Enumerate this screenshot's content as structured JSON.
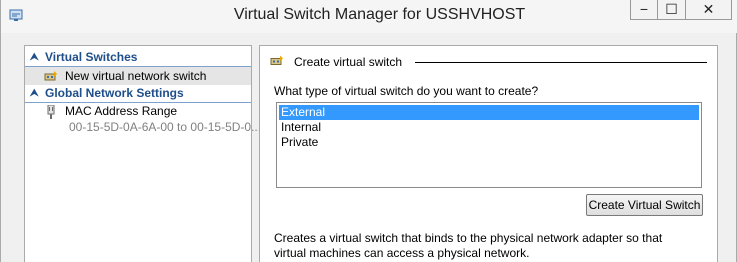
{
  "window": {
    "title": "Virtual Switch Manager for USSHVHOST",
    "minimize_glyph": "−",
    "maximize_glyph": "☐",
    "close_glyph": "✕"
  },
  "nav": {
    "virtual_switches_header": "Virtual Switches",
    "new_switch_item": "New virtual network switch",
    "global_settings_header": "Global Network Settings",
    "mac_range_label": "MAC Address Range",
    "mac_range_value": "00-15-5D-0A-6A-00 to 00-15-5D-0...",
    "collapse_glyph": "⮝"
  },
  "detail": {
    "header": "Create virtual switch",
    "question": "What type of virtual switch do you want to create?",
    "switch_types": [
      "External",
      "Internal",
      "Private"
    ],
    "selected_index": 0,
    "create_button": "Create Virtual Switch",
    "description": "Creates a virtual switch that binds to the physical network adapter so that virtual machines can access a physical network."
  },
  "icons": {
    "app": "virtual-switch-manager-icon",
    "new_switch": "virtual-switch-icon",
    "mac": "network-adapter-icon"
  },
  "colors": {
    "section_header": "#1e4f8a",
    "selection": "#3399ff",
    "nav_selected": "#e5e5e5"
  }
}
